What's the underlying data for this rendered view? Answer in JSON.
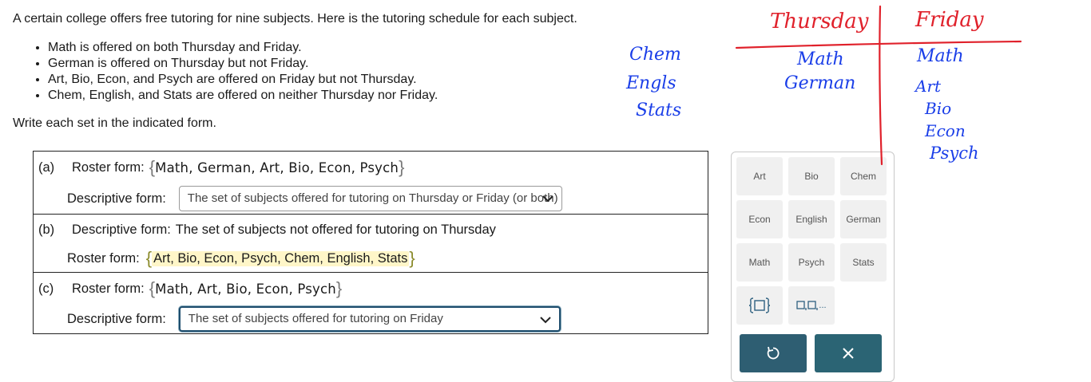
{
  "problem": {
    "intro": "A certain college offers free tutoring for nine subjects. Here is the tutoring schedule for each subject.",
    "bullets": [
      "Math is offered on both Thursday and Friday.",
      "German is offered on Thursday but not Friday.",
      "Art, Bio, Econ, and Psych are offered on Friday but not Thursday.",
      "Chem, English, and Stats are offered on neither Thursday nor Friday."
    ],
    "instruction": "Write each set in the indicated form."
  },
  "parts": {
    "a": {
      "tag": "(a)",
      "roster_label": "Roster form:",
      "roster_value": "Math, German, Art, Bio, Econ, Psych",
      "descriptive_label": "Descriptive form:",
      "descriptive_value": "The set of subjects offered for tutoring on Thursday or Friday (or both)"
    },
    "b": {
      "tag": "(b)",
      "descriptive_label": "Descriptive form:",
      "descriptive_text": "The set of subjects not offered for tutoring on Thursday",
      "roster_label": "Roster form:",
      "roster_value": "Art, Bio, Econ, Psych, Chem, English, Stats"
    },
    "c": {
      "tag": "(c)",
      "roster_label": "Roster form:",
      "roster_value": "Math, Art, Bio, Econ, Psych",
      "descriptive_label": "Descriptive form:",
      "descriptive_value": "The set of subjects offered for tutoring on Friday"
    }
  },
  "braces": {
    "open": "{",
    "close": "}"
  },
  "keypad": {
    "keys": [
      "Art",
      "Bio",
      "Chem",
      "Econ",
      "English",
      "German",
      "Math",
      "Psych",
      "Stats"
    ],
    "set_template_icon": "set-braces-icon",
    "list_template_icon": "list-template-icon",
    "list_template_suffix": "...",
    "undo_icon": "undo-icon",
    "clear_icon": "close-icon"
  },
  "annotations": {
    "thursday": "Thursday",
    "friday": "Friday",
    "thursday_items": [
      "Math",
      "German"
    ],
    "friday_items": [
      "Math",
      "Art",
      "Bio",
      "Econ",
      "Psych"
    ],
    "neither_items": [
      "Chem",
      "Engls",
      "Stats"
    ]
  },
  "colors": {
    "panel_button": "#2e5e72",
    "key_bg": "#f0f0f0",
    "highlight": "#fff6c8",
    "ink_red": "#e0212b",
    "ink_blue": "#1a3ee8"
  }
}
